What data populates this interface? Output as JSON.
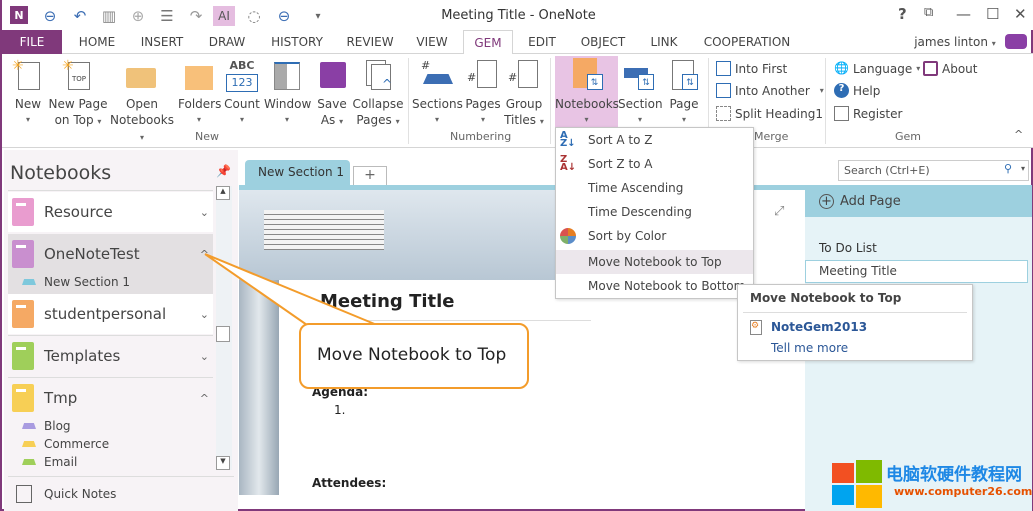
{
  "window": {
    "title": "Meeting Title - OneNote",
    "help": "?",
    "restore": "⧉",
    "minimize": "—",
    "maximize": "☐",
    "close": "✕"
  },
  "qat": [
    "onenote-logo-icon",
    "back-icon",
    "undo-icon",
    "dock-icon",
    "forward-icon",
    "full-page-icon",
    "redo-icon",
    "touch-mode-icon",
    "lasso-icon",
    "back-dropdown-icon",
    "customize-icon"
  ],
  "tabs": [
    "FILE",
    "HOME",
    "INSERT",
    "DRAW",
    "HISTORY",
    "REVIEW",
    "VIEW",
    "GEM",
    "EDIT",
    "OBJECT",
    "LINK",
    "COOPERATION"
  ],
  "active_tab": "GEM",
  "user": {
    "name": "james linton"
  },
  "ribbon": {
    "groups": {
      "new": "New",
      "numbering": "Numbering",
      "merge": "Merge",
      "gem": "Gem"
    },
    "buttons": {
      "new": "New",
      "new_page_top_1": "New Page",
      "new_page_top_2": "on Top",
      "open_nb_1": "Open",
      "open_nb_2": "Notebooks",
      "folders": "Folders",
      "count": "Count",
      "count_icon_abc": "ABC",
      "count_icon_123": "123",
      "window": "Window",
      "save_as_1": "Save",
      "save_as_2": "As",
      "collapse_1": "Collapse",
      "collapse_2": "Pages",
      "sections": "Sections",
      "pages": "Pages",
      "group_titles_1": "Group",
      "group_titles_2": "Titles",
      "notebooks": "Notebooks",
      "section": "Section",
      "page": "Page",
      "top_icon": "TOP",
      "hash": "#"
    },
    "merge": {
      "into_first": "Into First",
      "into_another": "Into Another",
      "split": "Split Heading1"
    },
    "gem": {
      "language": "Language",
      "about": "About",
      "help": "Help",
      "register": "Register"
    }
  },
  "sidebar": {
    "title": "Notebooks",
    "notebooks": [
      {
        "name": "Resource",
        "color": "#e99ccf",
        "expanded": false
      },
      {
        "name": "OneNoteTest",
        "color": "#c98fcf",
        "expanded": true,
        "sections": [
          {
            "name": "New Section 1",
            "color": "#7ec8dc"
          }
        ]
      },
      {
        "name": "studentpersonal",
        "color": "#f5a964",
        "expanded": false
      },
      {
        "name": "Templates",
        "color": "#9fcf5a",
        "expanded": false
      },
      {
        "name": "Tmp",
        "color": "#f7cf55",
        "expanded": true,
        "sections": [
          {
            "name": "Blog",
            "color": "#a99be0"
          },
          {
            "name": "Commerce",
            "color": "#f7cf55"
          },
          {
            "name": "Email",
            "color": "#9fcf5a"
          }
        ]
      }
    ],
    "quick_notes": "Quick Notes"
  },
  "section_tabs": [
    {
      "name": "New Section 1",
      "color": "#9dd0df"
    }
  ],
  "add_section": "+",
  "search": {
    "placeholder": "Search (Ctrl+E)"
  },
  "page": {
    "title": "Meeting Title",
    "agenda": "Agenda:",
    "item": "1.",
    "attendees": "Attendees:"
  },
  "pages_pane": {
    "add_page": "Add Page",
    "pages": [
      "To Do List",
      "Meeting Title"
    ],
    "selected": "Meeting Title"
  },
  "menu": {
    "items": [
      "Sort A to Z",
      "Sort Z to A",
      "Time Ascending",
      "Time Descending",
      "Sort by Color",
      "Move Notebook to Top",
      "Move Notebook to Bottom"
    ],
    "highlighted": "Move Notebook to Top"
  },
  "tooltip": {
    "title": "Move Notebook to Top",
    "product": "NoteGem2013",
    "link": "Tell me more"
  },
  "callout": "Move Notebook to Top",
  "watermark": {
    "cn": "电脑软硬件教程网",
    "url": "www.computer26.com"
  },
  "colors": {
    "accent": "#80397b",
    "section": "#9dd0df",
    "callout": "#f39c2b",
    "link": "#2b5797"
  }
}
